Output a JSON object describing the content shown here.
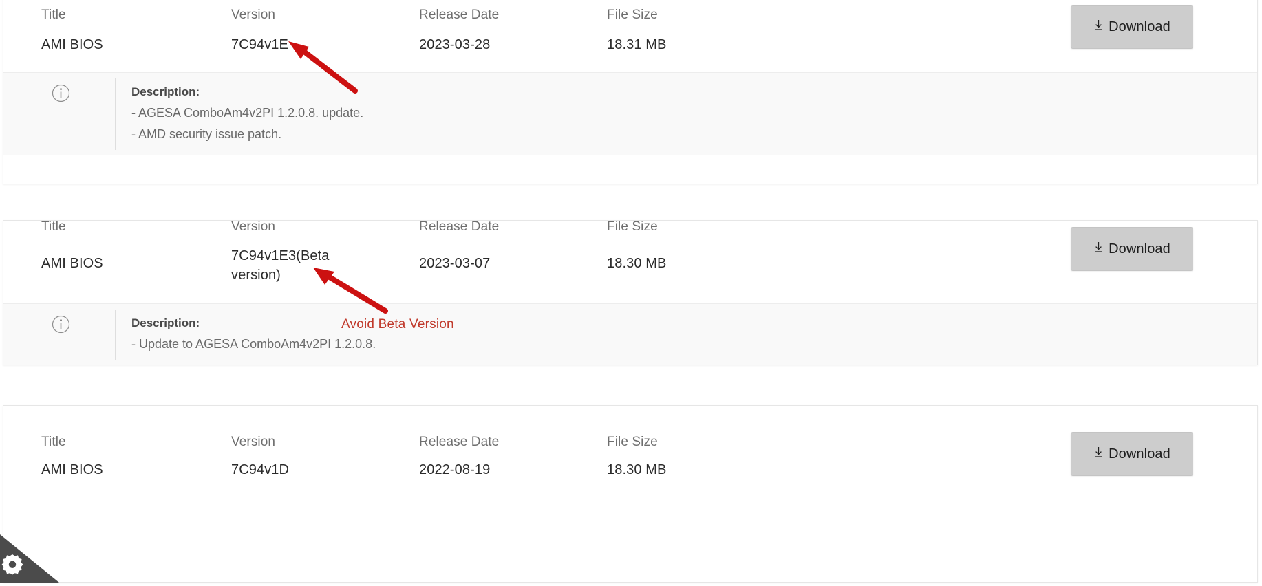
{
  "columns": {
    "title": "Title",
    "version": "Version",
    "release_date": "Release Date",
    "file_size": "File Size"
  },
  "download_button": {
    "label": "Download",
    "icon": "download-icon",
    "background_color": "#cdcdcd"
  },
  "description_label": "Description:",
  "cards": [
    {
      "title": "AMI BIOS",
      "version": "7C94v1E",
      "release_date": "2023-03-28",
      "file_size": "18.31 MB",
      "description_lines": [
        "- AGESA ComboAm4v2PI 1.2.0.8. update.",
        "- AMD security issue patch."
      ]
    },
    {
      "title": "AMI BIOS",
      "version": "7C94v1E3(Beta version)",
      "release_date": "2023-03-07",
      "file_size": "18.30 MB",
      "description_lines": [
        "- Update to AGESA ComboAm4v2PI 1.2.0.8."
      ]
    },
    {
      "title": "AMI BIOS",
      "version": "7C94v1D",
      "release_date": "2022-08-19",
      "file_size": "18.30 MB",
      "description_lines": []
    }
  ],
  "annotations": {
    "color": "#cc1111",
    "text_color": "#c0392b",
    "beta_warning": "Avoid Beta Version"
  }
}
